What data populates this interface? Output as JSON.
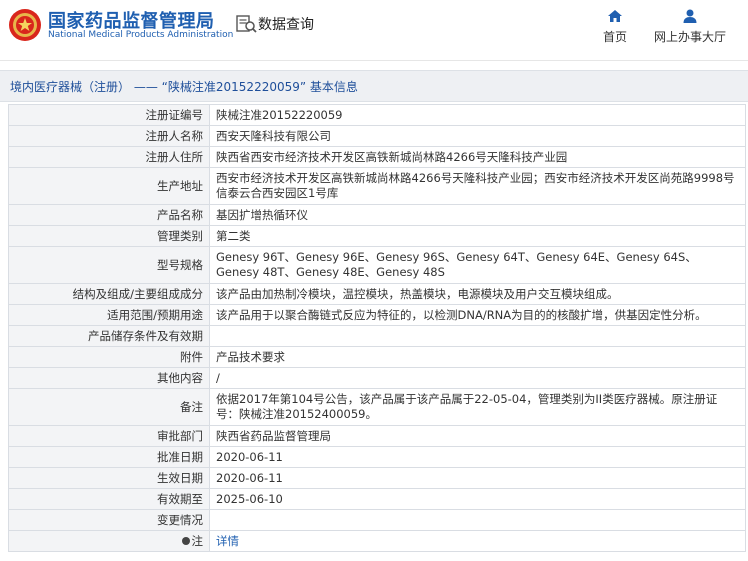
{
  "header": {
    "brand_cn": "国家药品监督管理局",
    "brand_en": "National Medical Products Administration",
    "query_title": "数据查询",
    "nav": [
      {
        "label": "首页",
        "icon": "home-icon"
      },
      {
        "label": "网上办事大厅",
        "icon": "user-icon"
      }
    ],
    "brand_color": "#1f5fb0",
    "logo_color": "#d9261c"
  },
  "title_bar": {
    "prefix": "境内医疗器械（注册）",
    "separator": "——",
    "suffix": "“陕械注准20152220059” 基本信息"
  },
  "rows": [
    {
      "label": "注册证编号",
      "value": "陕械注准20152220059"
    },
    {
      "label": "注册人名称",
      "value": "西安天隆科技有限公司"
    },
    {
      "label": "注册人住所",
      "value": "陕西省西安市经济技术开发区高铁新城尚林路4266号天隆科技产业园"
    },
    {
      "label": "生产地址",
      "value": "西安市经济技术开发区高铁新城尚林路4266号天隆科技产业园；西安市经济技术开发区尚苑路9998号信泰云合西安园区1号库"
    },
    {
      "label": "产品名称",
      "value": "基因扩增热循环仪"
    },
    {
      "label": "管理类别",
      "value": "第二类"
    },
    {
      "label": "型号规格",
      "value": "Genesy 96T、Genesy 96E、Genesy 96S、Genesy 64T、Genesy 64E、Genesy 64S、Genesy 48T、Genesy 48E、Genesy 48S"
    },
    {
      "label": "结构及组成/主要组成成分",
      "value": "该产品由加热制冷模块，温控模块，热盖模块，电源模块及用户交互模块组成。"
    },
    {
      "label": "适用范围/预期用途",
      "value": "该产品用于以聚合酶链式反应为特征的，以检测DNA/RNA为目的的核酸扩增，供基因定性分析。"
    },
    {
      "label": "产品储存条件及有效期",
      "value": ""
    },
    {
      "label": "附件",
      "value": "产品技术要求"
    },
    {
      "label": "其他内容",
      "value": "/"
    },
    {
      "label": "备注",
      "value": "依据2017年第104号公告，该产品属于该产品属于22-05-04，管理类别为II类医疗器械。原注册证号：陕械注准20152400059。"
    },
    {
      "label": "审批部门",
      "value": "陕西省药品监督管理局"
    },
    {
      "label": "批准日期",
      "value": "2020-06-11"
    },
    {
      "label": "生效日期",
      "value": "2020-06-11"
    },
    {
      "label": "有效期至",
      "value": "2025-06-10"
    },
    {
      "label": "变更情况",
      "value": ""
    },
    {
      "label": "注",
      "value": "详情"
    }
  ]
}
